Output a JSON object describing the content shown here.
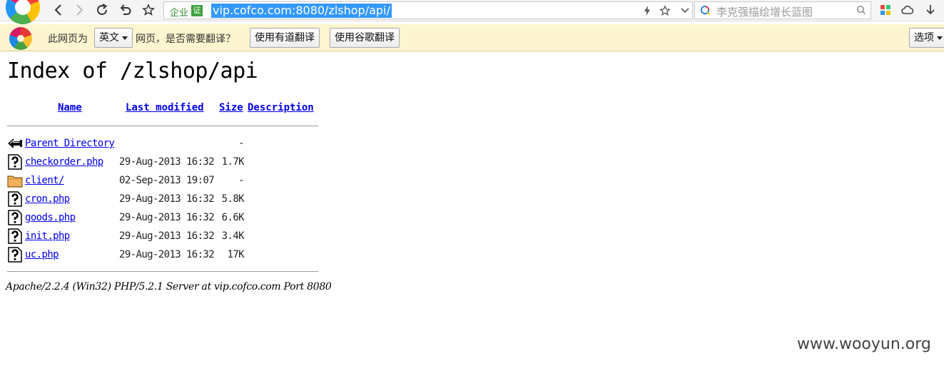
{
  "browser": {
    "url": "vip.cofco.com:8080/zlshop/api/",
    "cert_label": "企业",
    "cert_badge": "证",
    "search_placeholder": "李克强描绘增长蓝图"
  },
  "translate_bar": {
    "prefix": "此网页为",
    "language": "英文",
    "suffix": "网页，是否需要翻译？",
    "youdao_button": "使用有道翻译",
    "google_button": "使用谷歌翻译",
    "options_button": "选项"
  },
  "page": {
    "title": "Index of /zlshop/api",
    "columns": {
      "name": "Name",
      "last_modified": "Last modified",
      "size": "Size",
      "description": "Description"
    },
    "parent": {
      "label": "Parent Directory",
      "size": "-"
    },
    "files": [
      {
        "name": "checkorder.php",
        "modified": "29-Aug-2013 16:32",
        "size": "1.7K",
        "icon": "unknown-file-icon"
      },
      {
        "name": "client/",
        "modified": "02-Sep-2013 19:07",
        "size": "-",
        "icon": "folder-icon"
      },
      {
        "name": "cron.php",
        "modified": "29-Aug-2013 16:32",
        "size": "5.8K",
        "icon": "unknown-file-icon"
      },
      {
        "name": "goods.php",
        "modified": "29-Aug-2013 16:32",
        "size": "6.6K",
        "icon": "unknown-file-icon"
      },
      {
        "name": "init.php",
        "modified": "29-Aug-2013 16:32",
        "size": "3.4K",
        "icon": "unknown-file-icon"
      },
      {
        "name": "uc.php",
        "modified": "29-Aug-2013 16:32",
        "size": "17K",
        "icon": "unknown-file-icon"
      }
    ],
    "server_signature": "Apache/2.2.4 (Win32) PHP/5.2.1 Server at vip.cofco.com Port 8080"
  },
  "watermark": "www.wooyun.org"
}
